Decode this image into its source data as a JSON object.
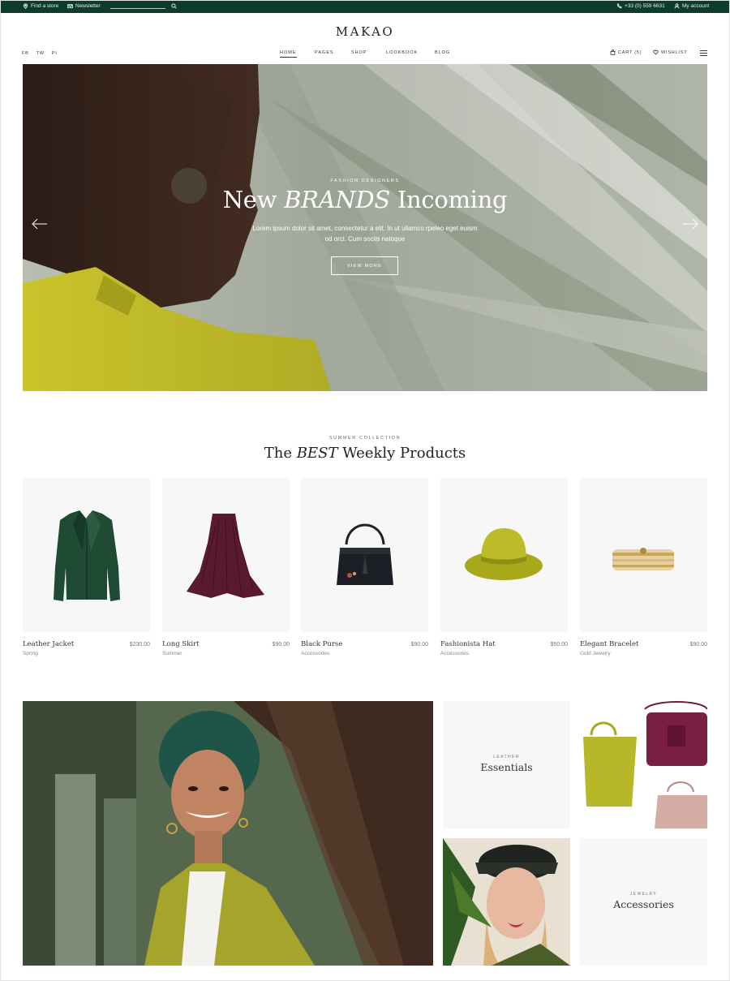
{
  "topbar": {
    "find_store": "Find a store",
    "newsletter": "Newsletter",
    "phone": "+33 (0) 559 6631",
    "account": "My account"
  },
  "brand": {
    "logo": "MAKAO"
  },
  "social": [
    "FB",
    "TW",
    "PI"
  ],
  "nav": {
    "home": "HOME",
    "pages": "PAGES",
    "shop": "SHOP",
    "lookbook": "LOOKBOOK",
    "blog": "BLOG"
  },
  "header_right": {
    "cart": "CART (5)",
    "wishlist": "WISHLIST"
  },
  "hero": {
    "eyebrow": "FASHION DESIGNERS",
    "title_pre": "New ",
    "title_em": "BRANDS",
    "title_post": " Incoming",
    "text": "Lorem ipsum dolor sit amet, consectetur a elit. In ut ullamco rpeleo eget euism od orci. Cum sociis natoque",
    "button": "VIEW MORE"
  },
  "products_section": {
    "eyebrow": "SUMMER COLLECTION",
    "title_pre": "The ",
    "title_em": "BEST",
    "title_post": " Weekly Products",
    "items": [
      {
        "name": "Leather Jacket",
        "price": "$230.00",
        "category": "Spring",
        "icon": "jacket"
      },
      {
        "name": "Long Skirt",
        "price": "$90.00",
        "category": "Summer",
        "icon": "skirt"
      },
      {
        "name": "Black Purse",
        "price": "$90.00",
        "category": "Accessories",
        "icon": "purse"
      },
      {
        "name": "Fashionista Hat",
        "price": "$50.00",
        "category": "Accessories",
        "icon": "hat"
      },
      {
        "name": "Elegant Bracelet",
        "price": "$90.00",
        "category": "Gold Jewelry",
        "icon": "bracelet"
      }
    ]
  },
  "categories": {
    "leather": {
      "eyebrow": "LEATHER",
      "title": "Essentials"
    },
    "jewelry": {
      "eyebrow": "JEWELRY",
      "title": "Accessories"
    }
  },
  "colors": {
    "topbar_bg": "#0c3d2a",
    "accent_lime": "#b5b626",
    "jacket_green": "#1f4a33",
    "skirt_burgundy": "#5a1a2e"
  }
}
